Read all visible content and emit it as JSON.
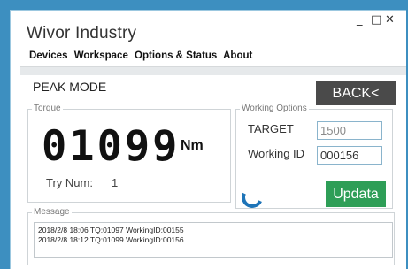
{
  "window": {
    "app_title": "Wivor Industry",
    "controls": {
      "minimize": "_",
      "maximize": "□",
      "close": "✕"
    }
  },
  "tabs": [
    {
      "label": "Devices"
    },
    {
      "label": "Workspace"
    },
    {
      "label": "Options & Status"
    },
    {
      "label": "About"
    }
  ],
  "main": {
    "mode_title": "PEAK MODE",
    "back_label": "BACK<"
  },
  "torque": {
    "group_label": "Torque",
    "value": "01099",
    "unit": "Nm",
    "try_label": "Try Num:",
    "try_value": "1"
  },
  "working_options": {
    "group_label": "Working Options",
    "target_label": "TARGET",
    "target_value": "1500",
    "id_label": "Working ID",
    "id_value": "000156",
    "update_label": "Updata",
    "spinner_icon": "loading-spinner-icon"
  },
  "message": {
    "group_label": "Message",
    "lines": [
      "2018/2/8 18:06 TQ:01097 WorkingID:00155",
      "2018/2/8 18:12 TQ:01099 WorkingID:00156"
    ]
  },
  "colors": {
    "background": "#3d8fc0",
    "back_button": "#4a4a4a",
    "update_button": "#2e9e57",
    "spinner": "#1e74b8"
  }
}
